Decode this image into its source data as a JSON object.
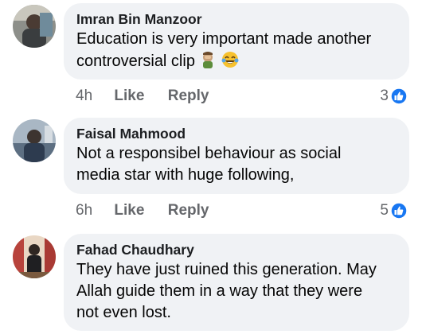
{
  "comments": [
    {
      "author": "Imran Bin Manzoor",
      "text": "Education is very important made another\ncontroversial clip",
      "emoji": [
        "facepalm-emoji",
        "tears-of-joy-emoji"
      ],
      "time": "4h",
      "like_label": "Like",
      "reply_label": "Reply",
      "reaction_count": "3",
      "reaction_icon": "like-reaction-icon"
    },
    {
      "author": "Faisal Mahmood",
      "text": "Not a responsibel behaviour as social\nmedia star with huge following,",
      "time": "6h",
      "like_label": "Like",
      "reply_label": "Reply",
      "reaction_count": "5",
      "reaction_icon": "like-reaction-icon"
    },
    {
      "author": "Fahad Chaudhary",
      "text": "They have just ruined this generation. May\nAllah guide them in a way that they were\nnot even lost."
    }
  ],
  "colors": {
    "bubble": "#f0f2f5",
    "secondary_text": "#65676b",
    "like_blue": "#1877f2"
  }
}
